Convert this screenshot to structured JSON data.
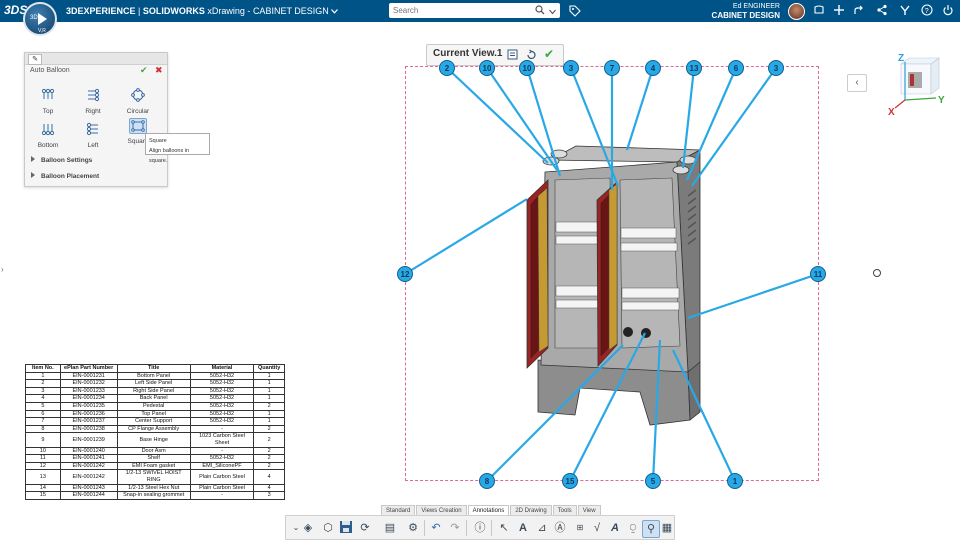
{
  "topbar": {
    "brand_logo": "3DS",
    "brand": "3DEXPERIENCE",
    "product": "SOLIDWORKS",
    "app": "xDrawing",
    "separator": "-",
    "document": "CABINET DESIGN",
    "compass": {
      "left": "3D",
      "bottom": "V,R"
    },
    "search_placeholder": "Search",
    "user_name": "Ed ENGINEER",
    "user_app": "CABINET DESIGN",
    "icons": [
      "share-icon",
      "add-icon",
      "share-arrow-icon",
      "network-icon",
      "apps-icon",
      "help-icon",
      "power-icon"
    ]
  },
  "auto_balloon": {
    "title": "Auto Balloon",
    "options": [
      {
        "label": "Top",
        "icon": "balloon-top-icon"
      },
      {
        "label": "Right",
        "icon": "balloon-right-icon"
      },
      {
        "label": "Circular",
        "icon": "balloon-circular-icon"
      },
      {
        "label": "Bottom",
        "icon": "balloon-bottom-icon"
      },
      {
        "label": "Left",
        "icon": "balloon-left-icon"
      },
      {
        "label": "Square",
        "icon": "balloon-square-icon"
      }
    ],
    "sections": [
      "Balloon Settings",
      "Balloon Placement"
    ],
    "tooltip_title": "Square",
    "tooltip_text": "Align balloons in square."
  },
  "current_view": {
    "label": "Current View.1"
  },
  "balloons": [
    "2",
    "10",
    "10",
    "3",
    "7",
    "4",
    "13",
    "6",
    "3",
    "12",
    "11",
    "8",
    "15",
    "5",
    "1"
  ],
  "bom": {
    "headers": [
      "Item No.",
      "ePlan Part Number",
      "Title",
      "Material",
      "Quantity"
    ],
    "rows": [
      [
        "1",
        "EIN-0001231",
        "Bottom Panel",
        "5052-H32",
        "1"
      ],
      [
        "2",
        "EIN-0001232",
        "Left Side Panel",
        "5052-H32",
        "1"
      ],
      [
        "3",
        "EIN-0001233",
        "Right Side Panel",
        "5052-H32",
        "1"
      ],
      [
        "4",
        "EIN-0001234",
        "Back Panel",
        "5052-H32",
        "1"
      ],
      [
        "5",
        "EIN-0001235",
        "Pedestal",
        "5052-H32",
        "2"
      ],
      [
        "6",
        "EIN-0001236",
        "Top Panel",
        "5052-H32",
        "1"
      ],
      [
        "7",
        "EIN-0001237",
        "Center Support",
        "5052-H32",
        "1"
      ],
      [
        "8",
        "EIN-0001238",
        "CP Flange Assembly",
        "-",
        "2"
      ],
      [
        "9",
        "EIN-0001239",
        "Base Hinge",
        "1023 Carbon Steel Sheet",
        "2"
      ],
      [
        "10",
        "EIN-0001240",
        "Door Asm",
        "-",
        "2"
      ],
      [
        "11",
        "EIN-0001241",
        "Shelf",
        "5052-H32",
        "2"
      ],
      [
        "12",
        "EIN-0001242",
        "EMI Foam gasket",
        "EMI_SiliconePF",
        "2"
      ],
      [
        "13",
        "EIN-0001242",
        "1/2-13 SWIVEL HOIST RING",
        "Plain Carbon Steel",
        "4"
      ],
      [
        "14",
        "EIN-0001243",
        "1/2-13 Steel Hex Nut",
        "Plain Carbon Steel",
        "4"
      ],
      [
        "15",
        "EIN-0001244",
        "Snap-in sealing grommet",
        "-",
        "3"
      ]
    ]
  },
  "viewcube": {
    "z": "Z",
    "y": "Y",
    "x": "X"
  },
  "bottom_tabs": [
    "Standard",
    "Views Creation",
    "Annotations",
    "2D Drawing",
    "Tools",
    "View"
  ],
  "active_tab": "Annotations",
  "colors": {
    "topbar": "#005386",
    "balloon_fill": "#29a8e6",
    "leader": "#29a8e6",
    "frame": "#e0679b",
    "door_red": "#9b2323"
  }
}
